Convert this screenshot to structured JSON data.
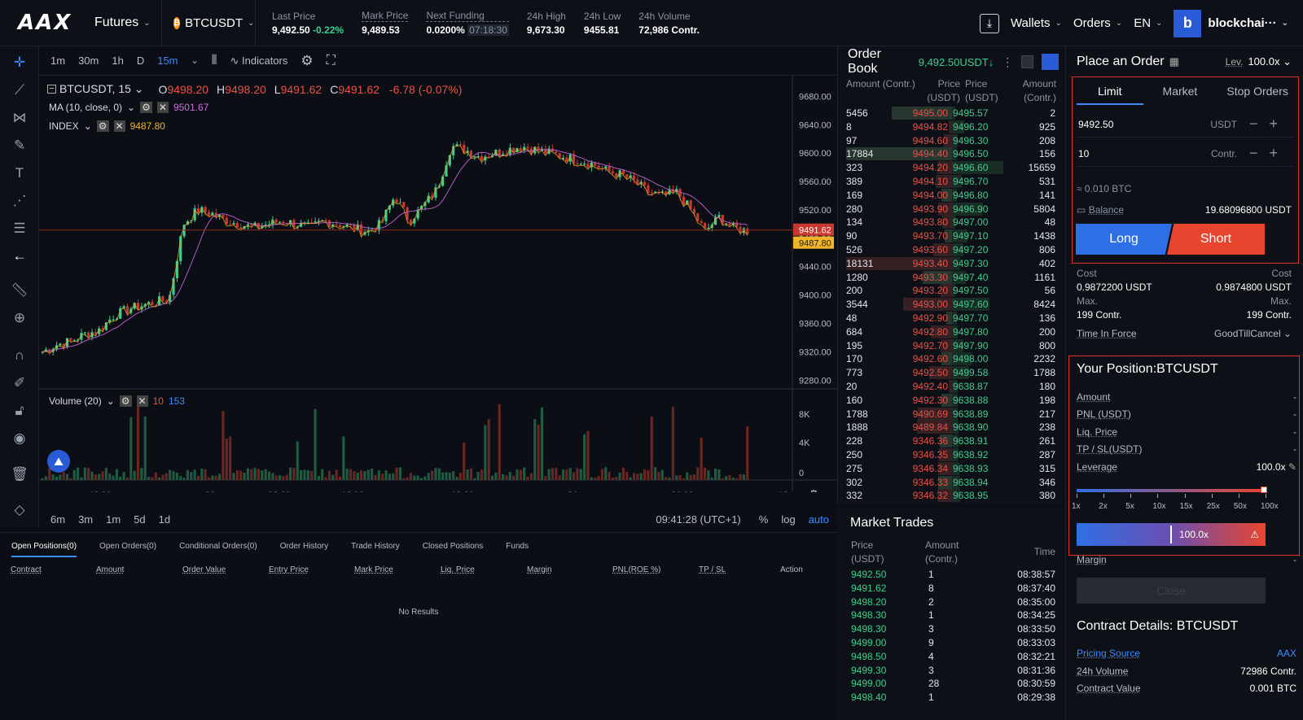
{
  "topbar": {
    "logo": "AAX",
    "product": "Futures",
    "symbol": "BTCUSDT",
    "stats": [
      {
        "label": "Last Price",
        "value": "9,492.50",
        "change": "-0.22%"
      },
      {
        "label": "Mark Price",
        "value": "9,489.53"
      },
      {
        "label": "Next Funding",
        "value": "0.0200%",
        "countdown": "07:18:30"
      },
      {
        "label": "24h High",
        "value": "9,673.30"
      },
      {
        "label": "24h Low",
        "value": "9455.81"
      },
      {
        "label": "24h Volume",
        "value": "72,986 Contr."
      }
    ],
    "wallets": "Wallets",
    "orders": "Orders",
    "lang": "EN",
    "avatar_letter": "b",
    "account": "blockchai···"
  },
  "chart_toolbar": {
    "intervals": [
      "1m",
      "30m",
      "1h",
      "D",
      "15m"
    ],
    "active_interval": "15m",
    "indicators": "Indicators"
  },
  "chart_legend": {
    "title": "BTCUSDT, 15",
    "o_label": "O",
    "o": "9498.20",
    "h_label": "H",
    "h": "9498.20",
    "l_label": "L",
    "l": "9491.62",
    "c_label": "C",
    "c": "9491.62",
    "chg": "-6.78 (-0.07%)",
    "ma": "MA (10, close, 0)",
    "ma_val": "9501.67",
    "index": "INDEX",
    "index_val": "9487.80",
    "volume": "Volume (20)",
    "vol_a": "10",
    "vol_b": "153"
  },
  "chart_data": {
    "type": "candlestick",
    "y_ticks": [
      "9680.00",
      "9640.00",
      "9600.00",
      "9560.00",
      "9520.00",
      "9480.00",
      "9440.00",
      "9400.00",
      "9360.00",
      "9320.00",
      "9280.00"
    ],
    "ylim": [
      9270,
      9700
    ],
    "x_ticks": [
      "18:00",
      "23",
      "08:00",
      "12:00",
      "18:00",
      "24",
      "06:00",
      "12:"
    ],
    "last_price_tag": "9491.62",
    "index_tag": "9487.80",
    "volume_ticks": [
      "8K",
      "4K",
      "0"
    ],
    "close_path": [
      9320,
      9330,
      9335,
      9345,
      9350,
      9370,
      9380,
      9385,
      9390,
      9395,
      9500,
      9520,
      9515,
      9505,
      9500,
      9495,
      9500,
      9505,
      9500,
      9495,
      9505,
      9500,
      9495,
      9490,
      9500,
      9540,
      9505,
      9525,
      9550,
      9610,
      9605,
      9595,
      9600,
      9605,
      9610,
      9605,
      9600,
      9595,
      9590,
      9585,
      9575,
      9570,
      9560,
      9545,
      9540,
      9545,
      9520,
      9490,
      9510,
      9495,
      9490
    ]
  },
  "chart_bottom": {
    "ranges": [
      "6m",
      "3m",
      "1m",
      "5d",
      "1d"
    ],
    "clock": "09:41:28 (UTC+1)",
    "pct": "%",
    "log": "log",
    "auto": "auto"
  },
  "positions": {
    "tabs": [
      "Open Positions(0)",
      "Open Orders(0)",
      "Conditional Orders(0)",
      "Order History",
      "Trade History",
      "Closed Positions",
      "Funds"
    ],
    "columns": [
      "Contract",
      "Amount",
      "Order Value",
      "Entry Price",
      "Mark Price",
      "Liq. Price",
      "Margin",
      "PNL(ROE %)",
      "TP / SL",
      "Action"
    ],
    "empty": "No Results"
  },
  "orderbook": {
    "title": "Order Book",
    "price": "9,492.50USDT",
    "arrow": "↓",
    "col_amount": "Amount (Contr.)",
    "col_price": "Price (USDT)",
    "rows": [
      {
        "ba": "5456",
        "bp": "9495.00",
        "ap": "9495.57",
        "aa": "2"
      },
      {
        "ba": "8",
        "bp": "9494.82",
        "ap": "9496.20",
        "aa": "925"
      },
      {
        "ba": "97",
        "bp": "9494.60",
        "ap": "9496.30",
        "aa": "208"
      },
      {
        "ba": "17884",
        "bp": "9494.40",
        "ap": "9496.50",
        "aa": "156"
      },
      {
        "ba": "323",
        "bp": "9494.20",
        "ap": "9496.60",
        "aa": "15659"
      },
      {
        "ba": "389",
        "bp": "9494.10",
        "ap": "9496.70",
        "aa": "531"
      },
      {
        "ba": "169",
        "bp": "9494.00",
        "ap": "9496.80",
        "aa": "141"
      },
      {
        "ba": "280",
        "bp": "9493.90",
        "ap": "9496.90",
        "aa": "5804"
      },
      {
        "ba": "134",
        "bp": "9493.80",
        "ap": "9497.00",
        "aa": "48"
      },
      {
        "ba": "90",
        "bp": "9493.70",
        "ap": "9497.10",
        "aa": "1438"
      },
      {
        "ba": "526",
        "bp": "9493.60",
        "ap": "9497.20",
        "aa": "806"
      },
      {
        "ba": "18131",
        "bp": "9493.40",
        "ap": "9497.30",
        "aa": "402"
      },
      {
        "ba": "1280",
        "bp": "9493.30",
        "ap": "9497.40",
        "aa": "1161"
      },
      {
        "ba": "200",
        "bp": "9493.20",
        "ap": "9497.50",
        "aa": "56"
      },
      {
        "ba": "3544",
        "bp": "9493.00",
        "ap": "9497.60",
        "aa": "8424"
      },
      {
        "ba": "48",
        "bp": "9492.90",
        "ap": "9497.70",
        "aa": "136"
      },
      {
        "ba": "684",
        "bp": "9492.80",
        "ap": "9497.80",
        "aa": "200"
      },
      {
        "ba": "195",
        "bp": "9492.70",
        "ap": "9497.90",
        "aa": "800"
      },
      {
        "ba": "170",
        "bp": "9492.60",
        "ap": "9498.00",
        "aa": "2232"
      },
      {
        "ba": "773",
        "bp": "9492.50",
        "ap": "9499.58",
        "aa": "1788"
      },
      {
        "ba": "20",
        "bp": "9492.40",
        "ap": "9638.87",
        "aa": "180"
      },
      {
        "ba": "160",
        "bp": "9492.30",
        "ap": "9638.88",
        "aa": "198"
      },
      {
        "ba": "1788",
        "bp": "9490.69",
        "ap": "9638.89",
        "aa": "217"
      },
      {
        "ba": "1888",
        "bp": "9489.84",
        "ap": "9638.90",
        "aa": "238"
      },
      {
        "ba": "228",
        "bp": "9346.36",
        "ap": "9638.91",
        "aa": "261"
      },
      {
        "ba": "250",
        "bp": "9346.35",
        "ap": "9638.92",
        "aa": "287"
      },
      {
        "ba": "275",
        "bp": "9346.34",
        "ap": "9638.93",
        "aa": "315"
      },
      {
        "ba": "302",
        "bp": "9346.33",
        "ap": "9638.94",
        "aa": "346"
      },
      {
        "ba": "332",
        "bp": "9346.32",
        "ap": "9638.95",
        "aa": "380"
      }
    ]
  },
  "trades": {
    "title": "Market Trades",
    "col_price": "Price (USDT)",
    "col_amount": "Amount (Contr.)",
    "col_time": "Time",
    "rows": [
      {
        "p": "9492.50",
        "a": "1",
        "t": "08:38:57"
      },
      {
        "p": "9491.62",
        "a": "8",
        "t": "08:37:40"
      },
      {
        "p": "9498.20",
        "a": "2",
        "t": "08:35:00"
      },
      {
        "p": "9498.30",
        "a": "1",
        "t": "08:34:25"
      },
      {
        "p": "9498.30",
        "a": "3",
        "t": "08:33:50"
      },
      {
        "p": "9499.00",
        "a": "9",
        "t": "08:33:03"
      },
      {
        "p": "9498.50",
        "a": "4",
        "t": "08:32:21"
      },
      {
        "p": "9499.30",
        "a": "3",
        "t": "08:31:36"
      },
      {
        "p": "9499.00",
        "a": "28",
        "t": "08:30:59"
      },
      {
        "p": "9498.40",
        "a": "1",
        "t": "08:29:38"
      }
    ]
  },
  "order_panel": {
    "title": "Place an Order",
    "lev_label": "Lev.",
    "lev_value": "100.0x",
    "tabs": [
      "Limit",
      "Market",
      "Stop Orders"
    ],
    "price_value": "9492.50",
    "price_unit": "USDT",
    "amount_value": "10",
    "amount_unit": "Contr.",
    "approx": "≈ 0.010  BTC",
    "balance_label": "Balance",
    "balance_value": "19.68096800 USDT",
    "long": "Long",
    "short": "Short",
    "cost_label": "Cost",
    "cost_long": "0.9872200 USDT",
    "cost_short": "0.9874800 USDT",
    "max_label": "Max.",
    "max_long": "199 Contr.",
    "max_short": "199 Contr.",
    "tif_label": "Time In Force",
    "tif_value": "GoodTillCancel"
  },
  "position_panel": {
    "title": "Your Position:BTCUSDT",
    "rows": [
      {
        "label": "Amount",
        "value": "-"
      },
      {
        "label": "PNL (USDT)",
        "value": "-"
      },
      {
        "label": "Liq. Price",
        "value": "-"
      },
      {
        "label": "TP / SL(USDT)",
        "value": "-"
      }
    ],
    "leverage_label": "Leverage",
    "leverage_value": "100.0x",
    "lev_level": 1.0,
    "lev_marks": [
      "1x",
      "2x",
      "5x",
      "10x",
      "15x",
      "25x",
      "50x",
      "100x"
    ],
    "lev_bar_value": "100.0x",
    "margin_label": "Margin",
    "margin_value": "-",
    "close": "Close"
  },
  "contract": {
    "title": "Contract Details: BTCUSDT",
    "pricing_source": "Pricing Source",
    "pricing_value": "AAX",
    "vol_label": "24h Volume",
    "vol_value": "72986 Contr.",
    "cv_label": "Contract Value",
    "cv_value": "0.001 BTC"
  }
}
